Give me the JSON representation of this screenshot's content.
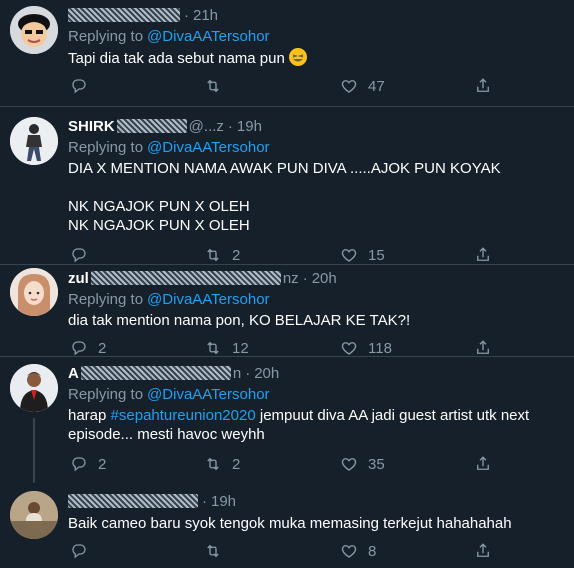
{
  "replying_label": "Replying to",
  "tweets": [
    {
      "name": "",
      "handle_tail": "",
      "time": "21h",
      "replying_to": "@DivaAATersohor",
      "text": "Tapi dia tak ada sebut nama pun",
      "replies": "",
      "retweets": "",
      "likes": "47"
    },
    {
      "name": "SHIRK",
      "handle_tail": "@...z",
      "time": "19h",
      "replying_to": "@DivaAATersohor",
      "text_lines": [
        "DIA X MENTION NAMA AWAK PUN DIVA .....AJOK PUN KOYAK",
        "",
        "NK NGAJOK PUN X OLEH",
        "NK NGAJOK PUN X OLEH"
      ],
      "replies": "",
      "retweets": "2",
      "likes": "15"
    },
    {
      "name": "zul",
      "handle_tail": "nz",
      "time": "20h",
      "replying_to": "@DivaAATersohor",
      "text": "dia tak mention nama pon, KO BELAJAR KE TAK?!",
      "replies": "2",
      "retweets": "12",
      "likes": "118"
    },
    {
      "name": "A",
      "handle_tail": "n",
      "time": "20h",
      "replying_to": "@DivaAATersohor",
      "text_before": "harap ",
      "hashtag": "#sepahtureunion2020",
      "text_after": " jempuut diva AA jadi guest artist utk next episode... mesti havoc weyhh",
      "replies": "2",
      "retweets": "2",
      "likes": "35"
    },
    {
      "name": "",
      "handle_tail": "",
      "time": "19h",
      "text": "Baik cameo baru syok tengok muka memasing terkejut hahahahah",
      "replies": "",
      "retweets": "",
      "likes": "8"
    }
  ],
  "colors": {
    "background": "#15202b",
    "muted": "#8899a6",
    "link": "#1da1f2",
    "divider": "#38444d"
  }
}
